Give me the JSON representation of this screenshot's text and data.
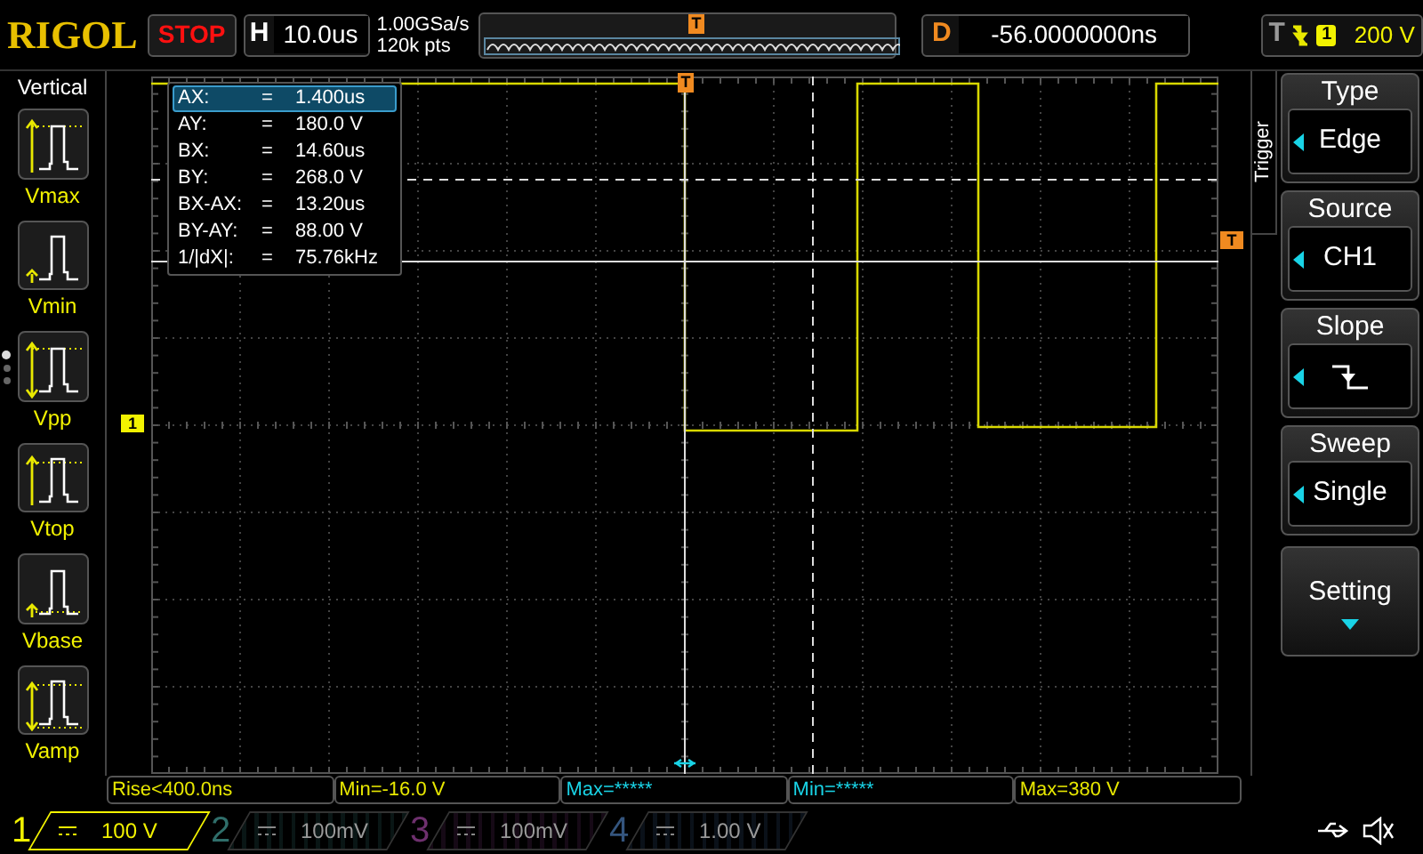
{
  "header": {
    "logo": "RIGOL",
    "run_state": "STOP",
    "timebase": {
      "label": "H",
      "value": "10.0us"
    },
    "sample_rate": "1.00GSa/s",
    "memory_depth": "120k pts",
    "overview_trigger_marker": "T",
    "delay": {
      "label": "D",
      "value": "-56.0000000ns"
    },
    "trigger": {
      "label": "T",
      "source": "1",
      "level": "200 V"
    }
  },
  "vertical_menu": {
    "title": "Vertical",
    "items": [
      {
        "kind": "max",
        "label": "Vmax"
      },
      {
        "kind": "min",
        "label": "Vmin"
      },
      {
        "kind": "pp",
        "label": "Vpp"
      },
      {
        "kind": "top",
        "label": "Vtop"
      },
      {
        "kind": "base",
        "label": "Vbase"
      },
      {
        "kind": "amp",
        "label": "Vamp"
      }
    ],
    "pages": [
      {
        "selected": true
      },
      {
        "selected": false
      },
      {
        "selected": false
      }
    ]
  },
  "cursor_readout": [
    {
      "label": "AX:",
      "sep": "=",
      "value": "1.400us",
      "selected": true
    },
    {
      "label": "AY:",
      "sep": "=",
      "value": "180.0 V",
      "selected": false
    },
    {
      "label": "BX:",
      "sep": "=",
      "value": "14.60us",
      "selected": false
    },
    {
      "label": "BY:",
      "sep": "=",
      "value": "268.0 V",
      "selected": false
    },
    {
      "label": "BX-AX:",
      "sep": "=",
      "value": "13.20us",
      "selected": false
    },
    {
      "label": "BY-AY:",
      "sep": "=",
      "value": "88.00 V",
      "selected": false
    },
    {
      "label": "1/|dX|:",
      "sep": "=",
      "value": "75.76kHz",
      "selected": false
    }
  ],
  "channel_marker": "1",
  "trigger_time_marker": "T",
  "trigger_level_marker": "T",
  "measurements": [
    {
      "text": "Rise<400.0ns",
      "color": "#e8e800"
    },
    {
      "text": "Min=-16.0 V",
      "color": "#e8e800"
    },
    {
      "text": "Max=*****",
      "color": "#19d3e6"
    },
    {
      "text": "Min=*****",
      "color": "#19d3e6"
    },
    {
      "text": "Max=380 V",
      "color": "#e8e800"
    }
  ],
  "channels": [
    {
      "number": "1",
      "scale": "100 V",
      "selected": true,
      "color": "#f2f200"
    },
    {
      "number": "2",
      "scale": "100mV",
      "selected": false,
      "color": "#2f6e6a"
    },
    {
      "number": "3",
      "scale": "100mV",
      "selected": false,
      "color": "#6e306e"
    },
    {
      "number": "4",
      "scale": "1.00 V",
      "selected": false,
      "color": "#34557e"
    }
  ],
  "trigger_menu": {
    "title": "Trigger",
    "items": [
      {
        "kind": "value",
        "label": "Type",
        "value": "Edge"
      },
      {
        "kind": "value",
        "label": "Source",
        "value": "CH1"
      },
      {
        "kind": "slope",
        "label": "Slope"
      },
      {
        "kind": "value",
        "label": "Sweep",
        "value": "Single"
      },
      {
        "kind": "more",
        "label": "Setting"
      }
    ]
  }
}
